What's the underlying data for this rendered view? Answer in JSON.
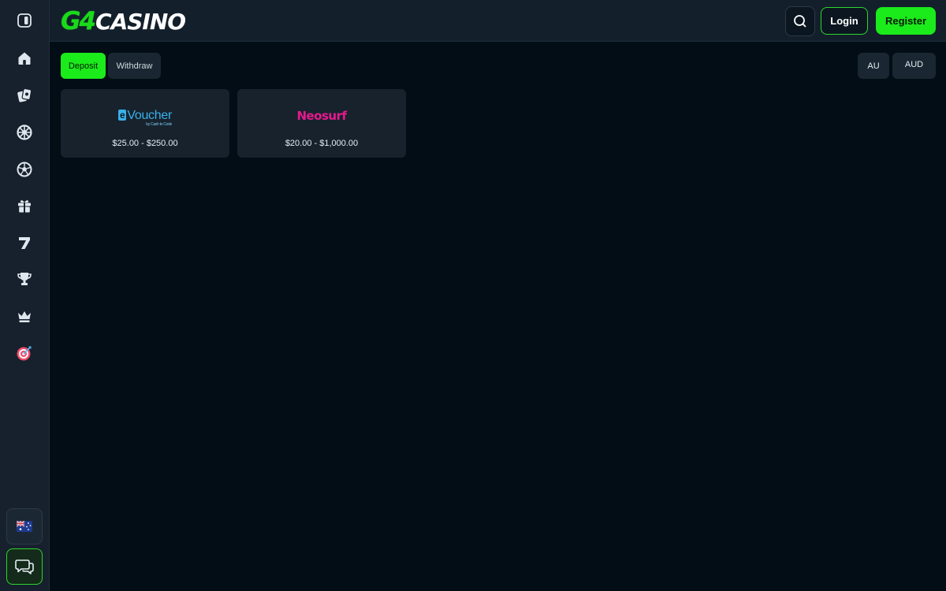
{
  "brand": {
    "logo_g4": "G4",
    "logo_casino": "CASINO",
    "accent_color": "#1bea1b"
  },
  "header": {
    "login_label": "Login",
    "register_label": "Register",
    "search_icon": "search-icon"
  },
  "sidebar": {
    "items": [
      {
        "name": "sidebar-toggle",
        "icon": "sidebar-toggle-icon"
      },
      {
        "name": "home",
        "icon": "home-icon"
      },
      {
        "name": "casino",
        "icon": "cards-icon"
      },
      {
        "name": "live-casino",
        "icon": "roulette-icon"
      },
      {
        "name": "sports",
        "icon": "soccer-ball-icon"
      },
      {
        "name": "promotions",
        "icon": "gift-icon"
      },
      {
        "name": "slots",
        "icon": "seven-icon"
      },
      {
        "name": "tournaments",
        "icon": "trophy-icon"
      },
      {
        "name": "vip",
        "icon": "crown-icon"
      },
      {
        "name": "missions",
        "icon": "target-icon"
      }
    ],
    "language_flag": "australia-flag-icon",
    "chat_icon": "chat-icon"
  },
  "main": {
    "tabs": [
      {
        "label": "Deposit",
        "active": true
      },
      {
        "label": "Withdraw",
        "active": false
      }
    ],
    "country": "AU",
    "currency": "AUD",
    "methods": [
      {
        "name": "eVoucher",
        "logo_main": "Voucher",
        "logo_badge": "e",
        "logo_sub": "by Cash to Code",
        "range": "$25.00 - $250.00"
      },
      {
        "name": "Neosurf",
        "logo_main": "Neosurf",
        "range": "$20.00 - $1,000.00"
      }
    ]
  }
}
